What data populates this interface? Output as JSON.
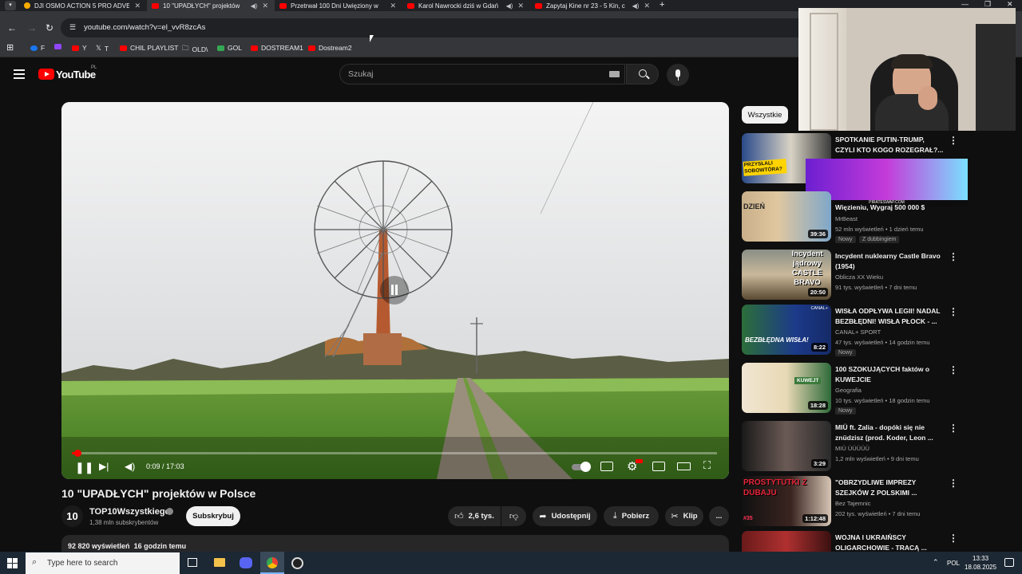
{
  "browser": {
    "tabs": [
      {
        "label": "DJI OSMO ACTION 5 PRO ADVE",
        "active": false
      },
      {
        "label": "10 \"UPADŁYCH\" projektów",
        "active": true
      },
      {
        "label": "Przetrwał 100 Dni Uwięziony w",
        "active": false
      },
      {
        "label": "Karol Nawrocki dziś w Gdań",
        "active": false
      },
      {
        "label": "Zapytaj Kine nr 23 - 5 Kin, c",
        "active": false
      }
    ],
    "url": "youtube.com/watch?v=el_vvR8zcAs",
    "bookmarks": [
      "F",
      "Y",
      "T",
      "CHIL PLAYLIST",
      "OLD\\",
      "GOL",
      "DOSTREAM1",
      "Dostream2"
    ]
  },
  "youtube": {
    "logo_text": "YouTube",
    "region": "PL",
    "search_placeholder": "Szukaj"
  },
  "player": {
    "current_time": "0:09",
    "duration": "17:03",
    "progress_fraction": 0.009
  },
  "video": {
    "title": "10 \"UPADŁYCH\" projektów w Polsce",
    "channel": "TOP10Wszystkiego",
    "channel_avatar_text": "10",
    "subscribers": "1,38 mln subskrybentów",
    "subscribe_label": "Subskrybuj",
    "likes": "2,6 tys.",
    "share_label": "Udostępnij",
    "download_label": "Pobierz",
    "clip_label": "Klip",
    "more_label": "...",
    "views": "92 820 wyświetleń",
    "uploaded": "16 godzin temu"
  },
  "sidebar": {
    "filter_chip": "Wszystkie",
    "items": [
      {
        "title": "SPOTKANIE PUTIN-TRUMP, CZYLI KTO KOGO ROZEGRAŁ?...",
        "channel": "",
        "meta": "",
        "duration": "",
        "badges": []
      },
      {
        "title": "Więzieniu, Wygraj 500 000 $",
        "channel": "MrBeast",
        "meta": "52 mln wyświetleń • 1 dzień temu",
        "duration": "39:36",
        "badges": [
          "Nowy",
          "Z dubbingiem"
        ]
      },
      {
        "title": "Incydent nuklearny Castle Bravo (1954)",
        "channel": "Oblicza XX Wieku",
        "meta": "91 tys. wyświetleń • 7 dni temu",
        "duration": "20:50",
        "badges": []
      },
      {
        "title": "WISŁA ODPŁYWA LEGII! NADAL BEZBŁĘDNI! WISŁA PŁOCK - ...",
        "channel": "CANAL+ SPORT",
        "meta": "47 tys. wyświetleń • 14 godzin temu",
        "duration": "8:22",
        "badges": [
          "Nowy"
        ]
      },
      {
        "title": "100 SZOKUJĄCYCH faktów o KUWEJCIE",
        "channel": "Geografia",
        "meta": "10 tys. wyświetleń • 18 godzin temu",
        "duration": "18:28",
        "badges": [
          "Nowy"
        ]
      },
      {
        "title": "MIÜ ft. Zalia - dopóki się nie znüdzisz (prod. Koder, Leon ...",
        "channel": "MIÜ ÜÜÜÜÜ",
        "meta": "1,2 mln wyświetleń • 9 dni temu",
        "duration": "3:29",
        "badges": []
      },
      {
        "title": "\"OBRZYDLIWE IMPREZY SZEJKÓW Z POLSKIMI ...",
        "channel": "Bez Tajemnic",
        "meta": "202 tys. wyświetleń • 7 dni temu",
        "duration": "1:12:48",
        "badges": []
      },
      {
        "title": "WOJNA I UKRAIŃSCY OLIGARCHOWIE - TRACĄ ...",
        "channel": "",
        "meta": "",
        "duration": "",
        "badges": []
      }
    ],
    "thumb_texts": {
      "t1": "PRZYSŁALI SOBOWTÓRA?",
      "t2": "DZIEŃ",
      "t3": "Incydent jądrowy CASTLE BRAVO",
      "t4": "BEZBŁĘDNA WISŁA!",
      "t4_logo": "CANAL+",
      "t5": "KUWEJT",
      "t7": "PROSTYTUTKI Z DUBAJU",
      "t7_num": "#35"
    },
    "ad_text": "PIRATESWAP.COM"
  },
  "taskbar": {
    "search_placeholder": "Type here to search",
    "language": "POL",
    "time": "13:33",
    "date": "18.08.2025"
  },
  "colors": {
    "accent": "#ff0000",
    "background": "#0f0f0f",
    "surface": "#272727"
  }
}
